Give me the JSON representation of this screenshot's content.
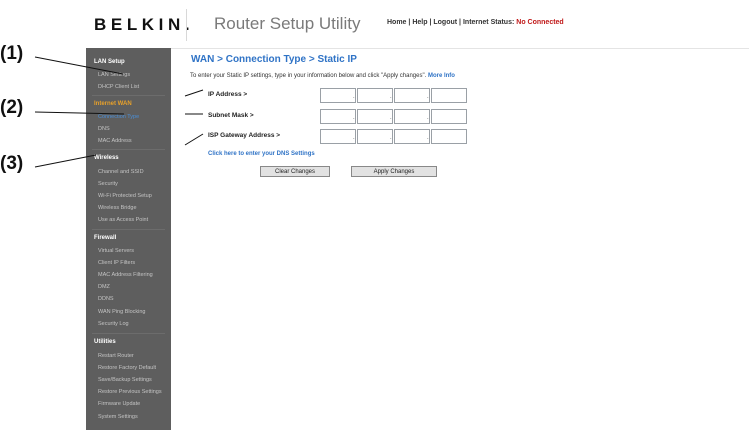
{
  "callouts": [
    "(1)",
    "(2)",
    "(3)"
  ],
  "header": {
    "logo": "BELKIN.",
    "title": "Router Setup Utility",
    "nav": {
      "home": "Home",
      "help": "Help",
      "logout": "Logout",
      "sep": "|",
      "status_label": "Internet Status:",
      "status_value": "No Connected"
    }
  },
  "sidebar": {
    "sections": [
      {
        "title": "LAN Setup",
        "items": [
          "LAN Settings",
          "DHCP Client List"
        ]
      },
      {
        "title": "Internet WAN",
        "items": [
          "Connection Type",
          "DNS",
          "MAC Address"
        ]
      },
      {
        "title": "Wireless",
        "items": [
          "Channel and SSID",
          "Security",
          "Wi-Fi Protected Setup",
          "Wireless Bridge",
          "Use as Access Point"
        ]
      },
      {
        "title": "Firewall",
        "items": [
          "Virtual Servers",
          "Client IP Filters",
          "MAC Address Filtering",
          "DMZ",
          "DDNS",
          "WAN Ping Blocking",
          "Security Log"
        ]
      },
      {
        "title": "Utilities",
        "items": [
          "Restart Router",
          "Restore Factory Default",
          "Save/Backup Settings",
          "Restore Previous Settings",
          "Firmware Update",
          "System Settings"
        ]
      }
    ],
    "active_section": "Internet WAN",
    "active_item": "Connection Type"
  },
  "main": {
    "heading": "WAN > Connection Type > Static IP",
    "intro": "To enter your Static IP settings, type in your information below and click \"Apply changes\".",
    "more_info": "More Info",
    "fields": [
      {
        "label": "IP Address >",
        "octets": [
          "",
          "",
          "",
          ""
        ]
      },
      {
        "label": "Subnet Mask >",
        "octets": [
          "",
          "",
          "",
          ""
        ]
      },
      {
        "label": "ISP Gateway Address >",
        "octets": [
          "",
          "",
          "",
          ""
        ]
      }
    ],
    "octet_separator": ".",
    "dns_link": "Click here to enter your DNS Settings",
    "buttons": {
      "clear": "Clear Changes",
      "apply": "Apply Changes"
    }
  },
  "colors": {
    "accent": "#2f73c6",
    "sidebar_bg": "#5e5e5e",
    "active_section": "#e8a12a",
    "status": "#c01818"
  }
}
